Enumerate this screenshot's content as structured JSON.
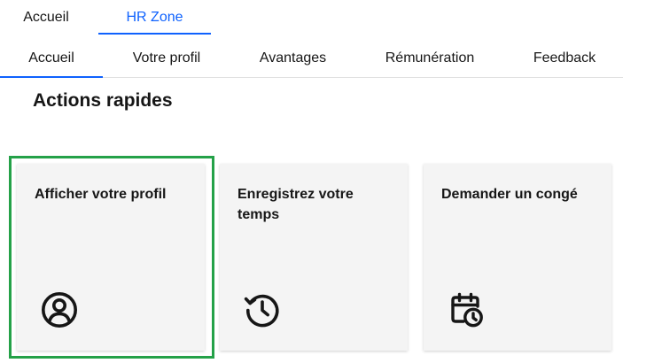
{
  "top_tabs": [
    {
      "label": "Accueil"
    },
    {
      "label": "HR Zone",
      "selected": true
    }
  ],
  "sub_tabs": [
    {
      "label": "Accueil",
      "selected": true
    },
    {
      "label": "Votre profil"
    },
    {
      "label": "Avantages"
    },
    {
      "label": "Rémunération"
    },
    {
      "label": "Feedback"
    }
  ],
  "section": {
    "title": "Actions rapides"
  },
  "cards": [
    {
      "title": "Afficher votre profil",
      "icon": "user-profile-icon",
      "focused": true
    },
    {
      "title": "Enregistrez votre temps",
      "icon": "history-clock-icon"
    },
    {
      "title": "Demander un congé",
      "icon": "calendar-clock-icon"
    }
  ],
  "colors": {
    "accent": "#0f62fe",
    "focus": "#24a148",
    "card_bg": "#f4f4f4",
    "text": "#161616"
  }
}
